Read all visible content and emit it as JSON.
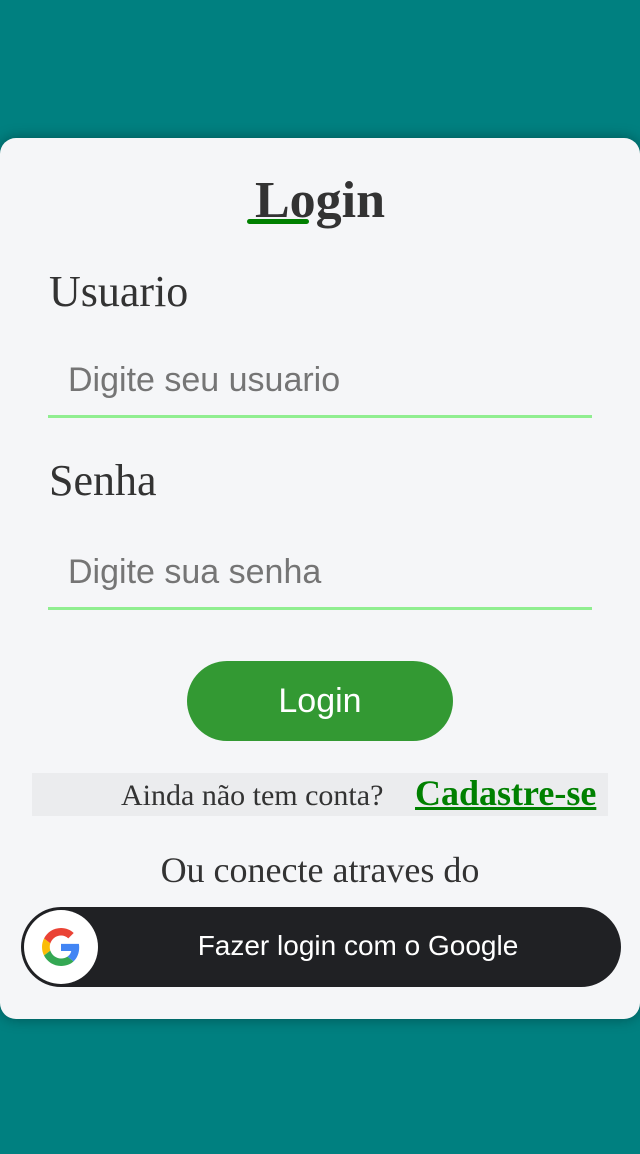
{
  "login_form": {
    "title": "Login",
    "username": {
      "label": "Usuario",
      "placeholder": "Digite seu usuario",
      "value": ""
    },
    "password": {
      "label": "Senha",
      "placeholder": "Digite sua senha",
      "value": ""
    },
    "submit_label": "Login",
    "signup": {
      "prompt": "Ainda não tem conta?",
      "link_label": "Cadastre-se"
    },
    "alt_prompt": "Ou conecte atraves do",
    "google_button": {
      "label": "Fazer login com o Google",
      "icon": "google-g-icon"
    }
  },
  "colors": {
    "background": "#008080",
    "card": "#f5f6f8",
    "accent_green": "#339933",
    "link_green": "#008000",
    "input_underline": "#90ee90",
    "google_button": "#202124"
  }
}
